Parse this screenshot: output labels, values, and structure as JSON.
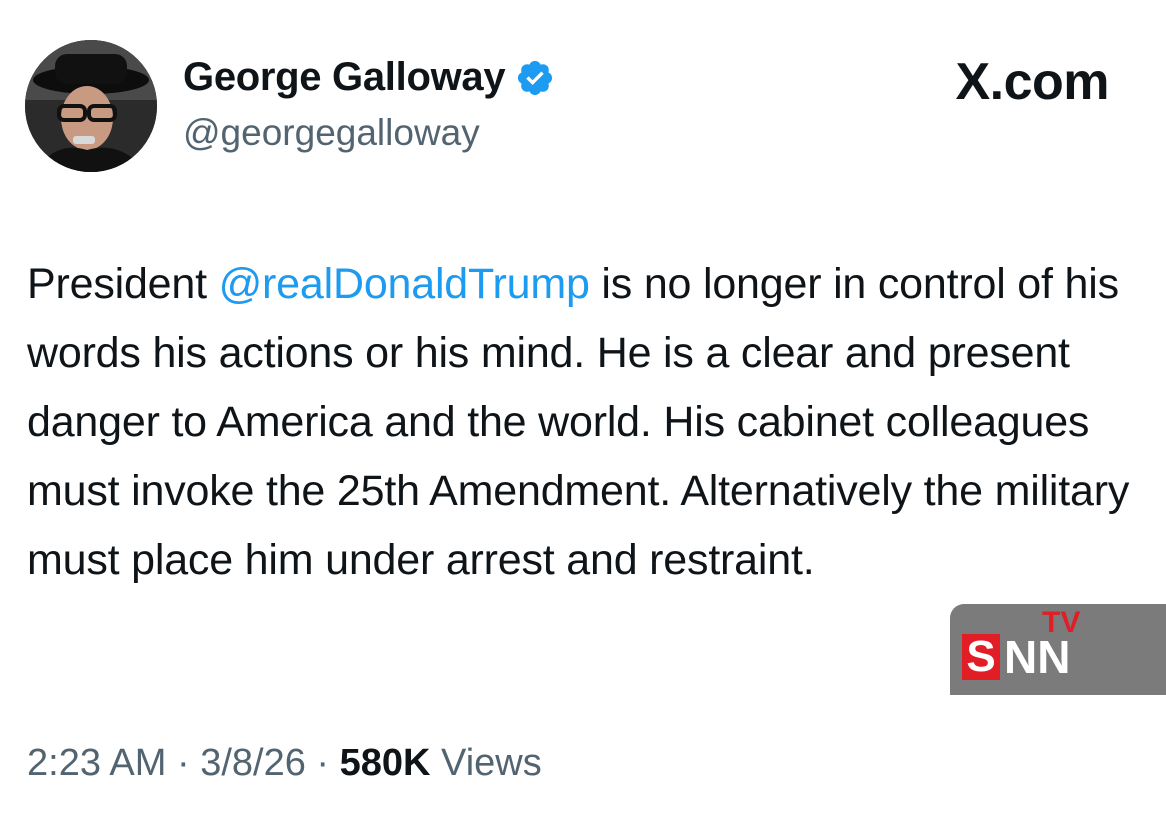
{
  "author": {
    "display_name": "George Galloway",
    "handle": "@georgegalloway",
    "verified": true
  },
  "site_label": "X.com",
  "tweet": {
    "text_before": "President ",
    "mention": "@realDonaldTrump",
    "text_after": " is no longer in control of his words his actions or his mind. He is a clear and present danger to America and the world. His cabinet colleagues must invoke the 25th Amendment. Alternatively the military must place him under arrest and restraint."
  },
  "meta": {
    "time": "2:23 AM",
    "separator": "·",
    "date": "3/8/26",
    "views_count": "580K",
    "views_label": "Views"
  },
  "watermark": {
    "tv": "TV",
    "s": "S",
    "nn": "NN"
  },
  "colors": {
    "mention": "#1d9bf0",
    "verified": "#1d9bf0",
    "secondary_text": "#536471",
    "watermark_bg": "#7b7b7b",
    "watermark_red": "#e11d26"
  }
}
